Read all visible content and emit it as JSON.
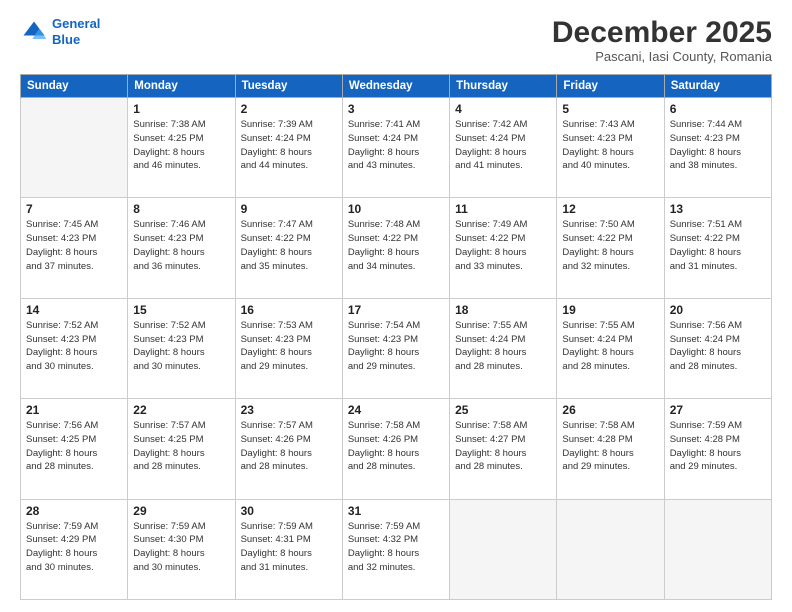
{
  "logo": {
    "line1": "General",
    "line2": "Blue"
  },
  "title": "December 2025",
  "subtitle": "Pascani, Iasi County, Romania",
  "weekdays": [
    "Sunday",
    "Monday",
    "Tuesday",
    "Wednesday",
    "Thursday",
    "Friday",
    "Saturday"
  ],
  "weeks": [
    [
      {
        "day": "",
        "info": ""
      },
      {
        "day": "1",
        "info": "Sunrise: 7:38 AM\nSunset: 4:25 PM\nDaylight: 8 hours\nand 46 minutes."
      },
      {
        "day": "2",
        "info": "Sunrise: 7:39 AM\nSunset: 4:24 PM\nDaylight: 8 hours\nand 44 minutes."
      },
      {
        "day": "3",
        "info": "Sunrise: 7:41 AM\nSunset: 4:24 PM\nDaylight: 8 hours\nand 43 minutes."
      },
      {
        "day": "4",
        "info": "Sunrise: 7:42 AM\nSunset: 4:24 PM\nDaylight: 8 hours\nand 41 minutes."
      },
      {
        "day": "5",
        "info": "Sunrise: 7:43 AM\nSunset: 4:23 PM\nDaylight: 8 hours\nand 40 minutes."
      },
      {
        "day": "6",
        "info": "Sunrise: 7:44 AM\nSunset: 4:23 PM\nDaylight: 8 hours\nand 38 minutes."
      }
    ],
    [
      {
        "day": "7",
        "info": "Sunrise: 7:45 AM\nSunset: 4:23 PM\nDaylight: 8 hours\nand 37 minutes."
      },
      {
        "day": "8",
        "info": "Sunrise: 7:46 AM\nSunset: 4:23 PM\nDaylight: 8 hours\nand 36 minutes."
      },
      {
        "day": "9",
        "info": "Sunrise: 7:47 AM\nSunset: 4:22 PM\nDaylight: 8 hours\nand 35 minutes."
      },
      {
        "day": "10",
        "info": "Sunrise: 7:48 AM\nSunset: 4:22 PM\nDaylight: 8 hours\nand 34 minutes."
      },
      {
        "day": "11",
        "info": "Sunrise: 7:49 AM\nSunset: 4:22 PM\nDaylight: 8 hours\nand 33 minutes."
      },
      {
        "day": "12",
        "info": "Sunrise: 7:50 AM\nSunset: 4:22 PM\nDaylight: 8 hours\nand 32 minutes."
      },
      {
        "day": "13",
        "info": "Sunrise: 7:51 AM\nSunset: 4:22 PM\nDaylight: 8 hours\nand 31 minutes."
      }
    ],
    [
      {
        "day": "14",
        "info": "Sunrise: 7:52 AM\nSunset: 4:23 PM\nDaylight: 8 hours\nand 30 minutes."
      },
      {
        "day": "15",
        "info": "Sunrise: 7:52 AM\nSunset: 4:23 PM\nDaylight: 8 hours\nand 30 minutes."
      },
      {
        "day": "16",
        "info": "Sunrise: 7:53 AM\nSunset: 4:23 PM\nDaylight: 8 hours\nand 29 minutes."
      },
      {
        "day": "17",
        "info": "Sunrise: 7:54 AM\nSunset: 4:23 PM\nDaylight: 8 hours\nand 29 minutes."
      },
      {
        "day": "18",
        "info": "Sunrise: 7:55 AM\nSunset: 4:24 PM\nDaylight: 8 hours\nand 28 minutes."
      },
      {
        "day": "19",
        "info": "Sunrise: 7:55 AM\nSunset: 4:24 PM\nDaylight: 8 hours\nand 28 minutes."
      },
      {
        "day": "20",
        "info": "Sunrise: 7:56 AM\nSunset: 4:24 PM\nDaylight: 8 hours\nand 28 minutes."
      }
    ],
    [
      {
        "day": "21",
        "info": "Sunrise: 7:56 AM\nSunset: 4:25 PM\nDaylight: 8 hours\nand 28 minutes."
      },
      {
        "day": "22",
        "info": "Sunrise: 7:57 AM\nSunset: 4:25 PM\nDaylight: 8 hours\nand 28 minutes."
      },
      {
        "day": "23",
        "info": "Sunrise: 7:57 AM\nSunset: 4:26 PM\nDaylight: 8 hours\nand 28 minutes."
      },
      {
        "day": "24",
        "info": "Sunrise: 7:58 AM\nSunset: 4:26 PM\nDaylight: 8 hours\nand 28 minutes."
      },
      {
        "day": "25",
        "info": "Sunrise: 7:58 AM\nSunset: 4:27 PM\nDaylight: 8 hours\nand 28 minutes."
      },
      {
        "day": "26",
        "info": "Sunrise: 7:58 AM\nSunset: 4:28 PM\nDaylight: 8 hours\nand 29 minutes."
      },
      {
        "day": "27",
        "info": "Sunrise: 7:59 AM\nSunset: 4:28 PM\nDaylight: 8 hours\nand 29 minutes."
      }
    ],
    [
      {
        "day": "28",
        "info": "Sunrise: 7:59 AM\nSunset: 4:29 PM\nDaylight: 8 hours\nand 30 minutes."
      },
      {
        "day": "29",
        "info": "Sunrise: 7:59 AM\nSunset: 4:30 PM\nDaylight: 8 hours\nand 30 minutes."
      },
      {
        "day": "30",
        "info": "Sunrise: 7:59 AM\nSunset: 4:31 PM\nDaylight: 8 hours\nand 31 minutes."
      },
      {
        "day": "31",
        "info": "Sunrise: 7:59 AM\nSunset: 4:32 PM\nDaylight: 8 hours\nand 32 minutes."
      },
      {
        "day": "",
        "info": ""
      },
      {
        "day": "",
        "info": ""
      },
      {
        "day": "",
        "info": ""
      }
    ]
  ]
}
